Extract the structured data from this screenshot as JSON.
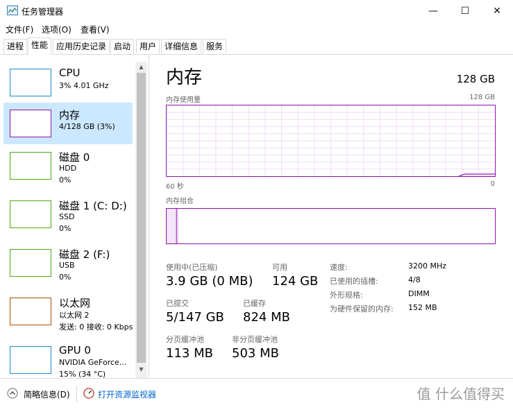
{
  "window": {
    "title": "任务管理器",
    "minimize": "—",
    "maximize": "☐",
    "close": "✕"
  },
  "menu": [
    "文件(F)",
    "选项(O)",
    "查看(V)"
  ],
  "tabs": [
    "进程",
    "性能",
    "应用历史记录",
    "启动",
    "用户",
    "详细信息",
    "服务"
  ],
  "sidebar": {
    "items": [
      {
        "title": "CPU",
        "line1": "3% 4.01 GHz",
        "line2": "",
        "color": "#1a8ac9"
      },
      {
        "title": "内存",
        "line1": "4/128 GB (3%)",
        "line2": "",
        "color": "#8b12ae"
      },
      {
        "title": "磁盘 0",
        "line1": "HDD",
        "line2": "0%",
        "color": "#4da60c"
      },
      {
        "title": "磁盘 1 (C: D:)",
        "line1": "SSD",
        "line2": "0%",
        "color": "#4da60c"
      },
      {
        "title": "磁盘 2 (F:)",
        "line1": "USB",
        "line2": "0%",
        "color": "#4da60c"
      },
      {
        "title": "以太网",
        "line1": "以太网 2",
        "line2": "发送: 0 接收: 0 Kbps",
        "color": "#a74f01"
      },
      {
        "title": "GPU 0",
        "line1": "NVIDIA GeForce...",
        "line2": "15% (34 °C)",
        "color": "#1a8ac9"
      }
    ]
  },
  "main": {
    "title": "内存",
    "total": "128 GB",
    "usage_graph": {
      "label": "内存使用量",
      "max": "128 GB",
      "left_axis": "60 秒",
      "right_axis": "0",
      "usage_fraction": 0.03
    },
    "composition": {
      "label": "内存组合",
      "in_use_fraction": 0.03,
      "modified_fraction": 0.004
    },
    "stats": [
      {
        "label": "使用中(已压缩)",
        "value": "3.9 GB (0 MB)"
      },
      {
        "label": "可用",
        "value": "124 GB"
      },
      {
        "label": "已提交",
        "value": "5/147 GB"
      },
      {
        "label": "已缓存",
        "value": "824 MB"
      },
      {
        "label": "分页缓冲池",
        "value": "113 MB"
      },
      {
        "label": "非分页缓冲池",
        "value": "503 MB"
      }
    ],
    "details": [
      {
        "label": "速度:",
        "value": "3200 MHz"
      },
      {
        "label": "已使用的插槽:",
        "value": "4/8"
      },
      {
        "label": "外形规格:",
        "value": "DIMM"
      },
      {
        "label": "为硬件保留的内存:",
        "value": "152 MB"
      }
    ]
  },
  "footer": {
    "less_details": "简略信息(D)",
    "open_monitor": "打开资源监视器"
  },
  "watermark": "值 什么值得买"
}
